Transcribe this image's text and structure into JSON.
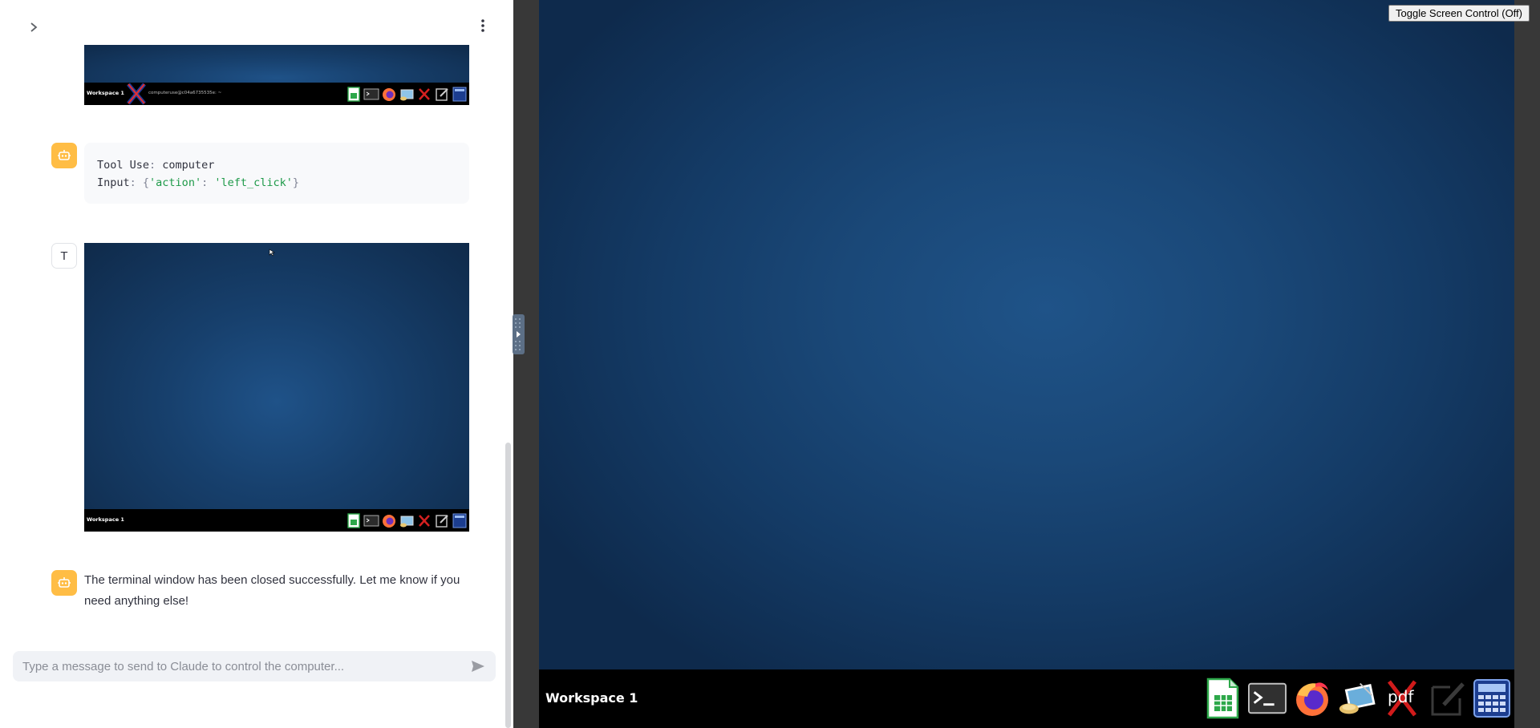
{
  "chat": {
    "tool_use_label": "Tool Use",
    "tool_use_value": "computer",
    "input_label": "Input",
    "input_open": "{",
    "input_key": "'action'",
    "input_value": "'left_click'",
    "input_close": "}",
    "user_avatar_letter": "T",
    "final_message": "The terminal window has been closed successfully. Let me know if you need anything else!",
    "input_placeholder": "Type a message to send to Claude to control the computer..."
  },
  "screenshot_1": {
    "workspace": "Workspace 1",
    "window_title": "computeruse@c04a6735535e: ~"
  },
  "screenshot_2": {
    "workspace": "Workspace 1"
  },
  "desktop": {
    "toggle_button": "Toggle Screen Control (Off)",
    "workspace": "Workspace 1",
    "dock_apps": [
      "spreadsheet-icon",
      "terminal-icon",
      "firefox-icon",
      "image-viewer-icon",
      "pdf-viewer-icon",
      "text-editor-icon",
      "calculator-icon"
    ],
    "pdf_label": "pdf"
  },
  "colors": {
    "bot_avatar": "#ffbd45",
    "desktop_bg": "#1a4878",
    "taskbar": "#000000",
    "code_string": "#1e9a49"
  }
}
